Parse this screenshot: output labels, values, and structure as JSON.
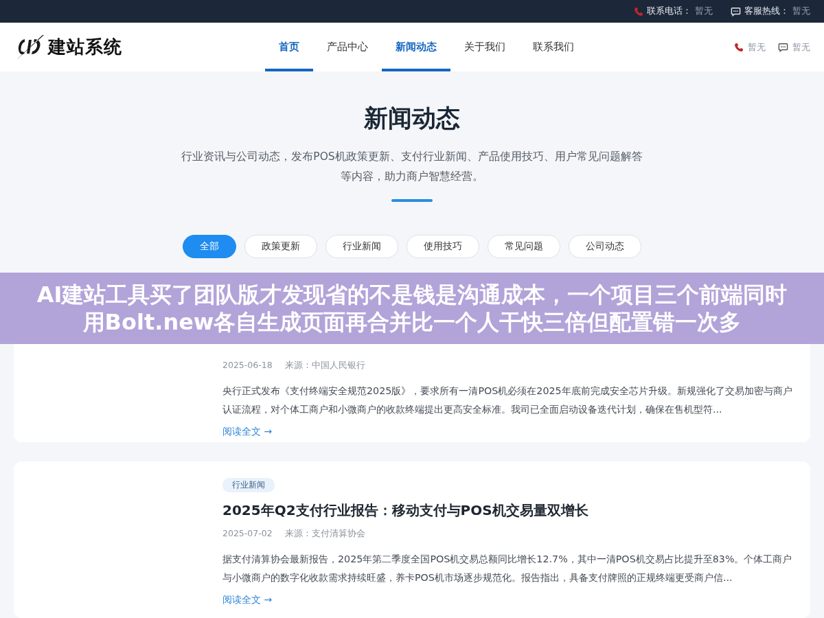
{
  "top_bar": {
    "items": [
      {
        "kind": "phone",
        "label": "联系电话：",
        "value": "暂无"
      },
      {
        "kind": "chat",
        "label": "客服热线：",
        "value": "暂无"
      }
    ]
  },
  "header": {
    "logo_text": "建站系统",
    "nav": [
      {
        "label": "首页",
        "selected": true
      },
      {
        "label": "产品中心",
        "selected": false
      },
      {
        "label": "新闻动态",
        "selected": true
      },
      {
        "label": "关于我们",
        "selected": false
      },
      {
        "label": "联系我们",
        "selected": false
      }
    ],
    "contacts": [
      {
        "kind": "phone",
        "value": "暂无"
      },
      {
        "kind": "chat",
        "value": "暂无"
      }
    ]
  },
  "hero": {
    "title": "新闻动态",
    "subtitle": "行业资讯与公司动态，发布POS机政策更新、支付行业新闻、产品使用技巧、用户常见问题解答等内容，助力商户智慧经营。"
  },
  "filters": [
    {
      "label": "全部",
      "selected": true
    },
    {
      "label": "政策更新",
      "selected": false
    },
    {
      "label": "行业新闻",
      "selected": false
    },
    {
      "label": "使用技巧",
      "selected": false
    },
    {
      "label": "常见问题",
      "selected": false
    },
    {
      "label": "公司动态",
      "selected": false
    }
  ],
  "articles": [
    {
      "date": "2025-06-18",
      "source": "来源：中国人民银行",
      "summary": "央行正式发布《支付终端安全规范2025版》，要求所有一清POS机必须在2025年底前完成安全芯片升级。新规强化了交易加密与商户认证流程，对个体工商户和小微商户的收款终端提出更高安全标准。我司已全面启动设备迭代计划，确保在售机型符...",
      "link": "阅读全文 →"
    },
    {
      "tag": "行业新闻",
      "title": "2025年Q2支付行业报告：移动支付与POS机交易量双增长",
      "date": "2025-07-02",
      "source": "来源：支付清算协会",
      "summary": "据支付清算协会最新报告，2025年第二季度全国POS机交易总额同比增长12.7%，其中一清POS机交易占比提升至83%。个体工商户与小微商户的数字化收款需求持续旺盛，养卡POS机市场逐步规范化。报告指出，具备支付牌照的正规终端更受商户信...",
      "link": "阅读全文 →"
    }
  ],
  "overlay_banner": {
    "text": "AI建站工具买了团队版才发现省的不是钱是沟通成本，一个项目三个前端同时用Bolt.new各自生成页面再合并比一个人干快三倍但配置错一次多"
  }
}
